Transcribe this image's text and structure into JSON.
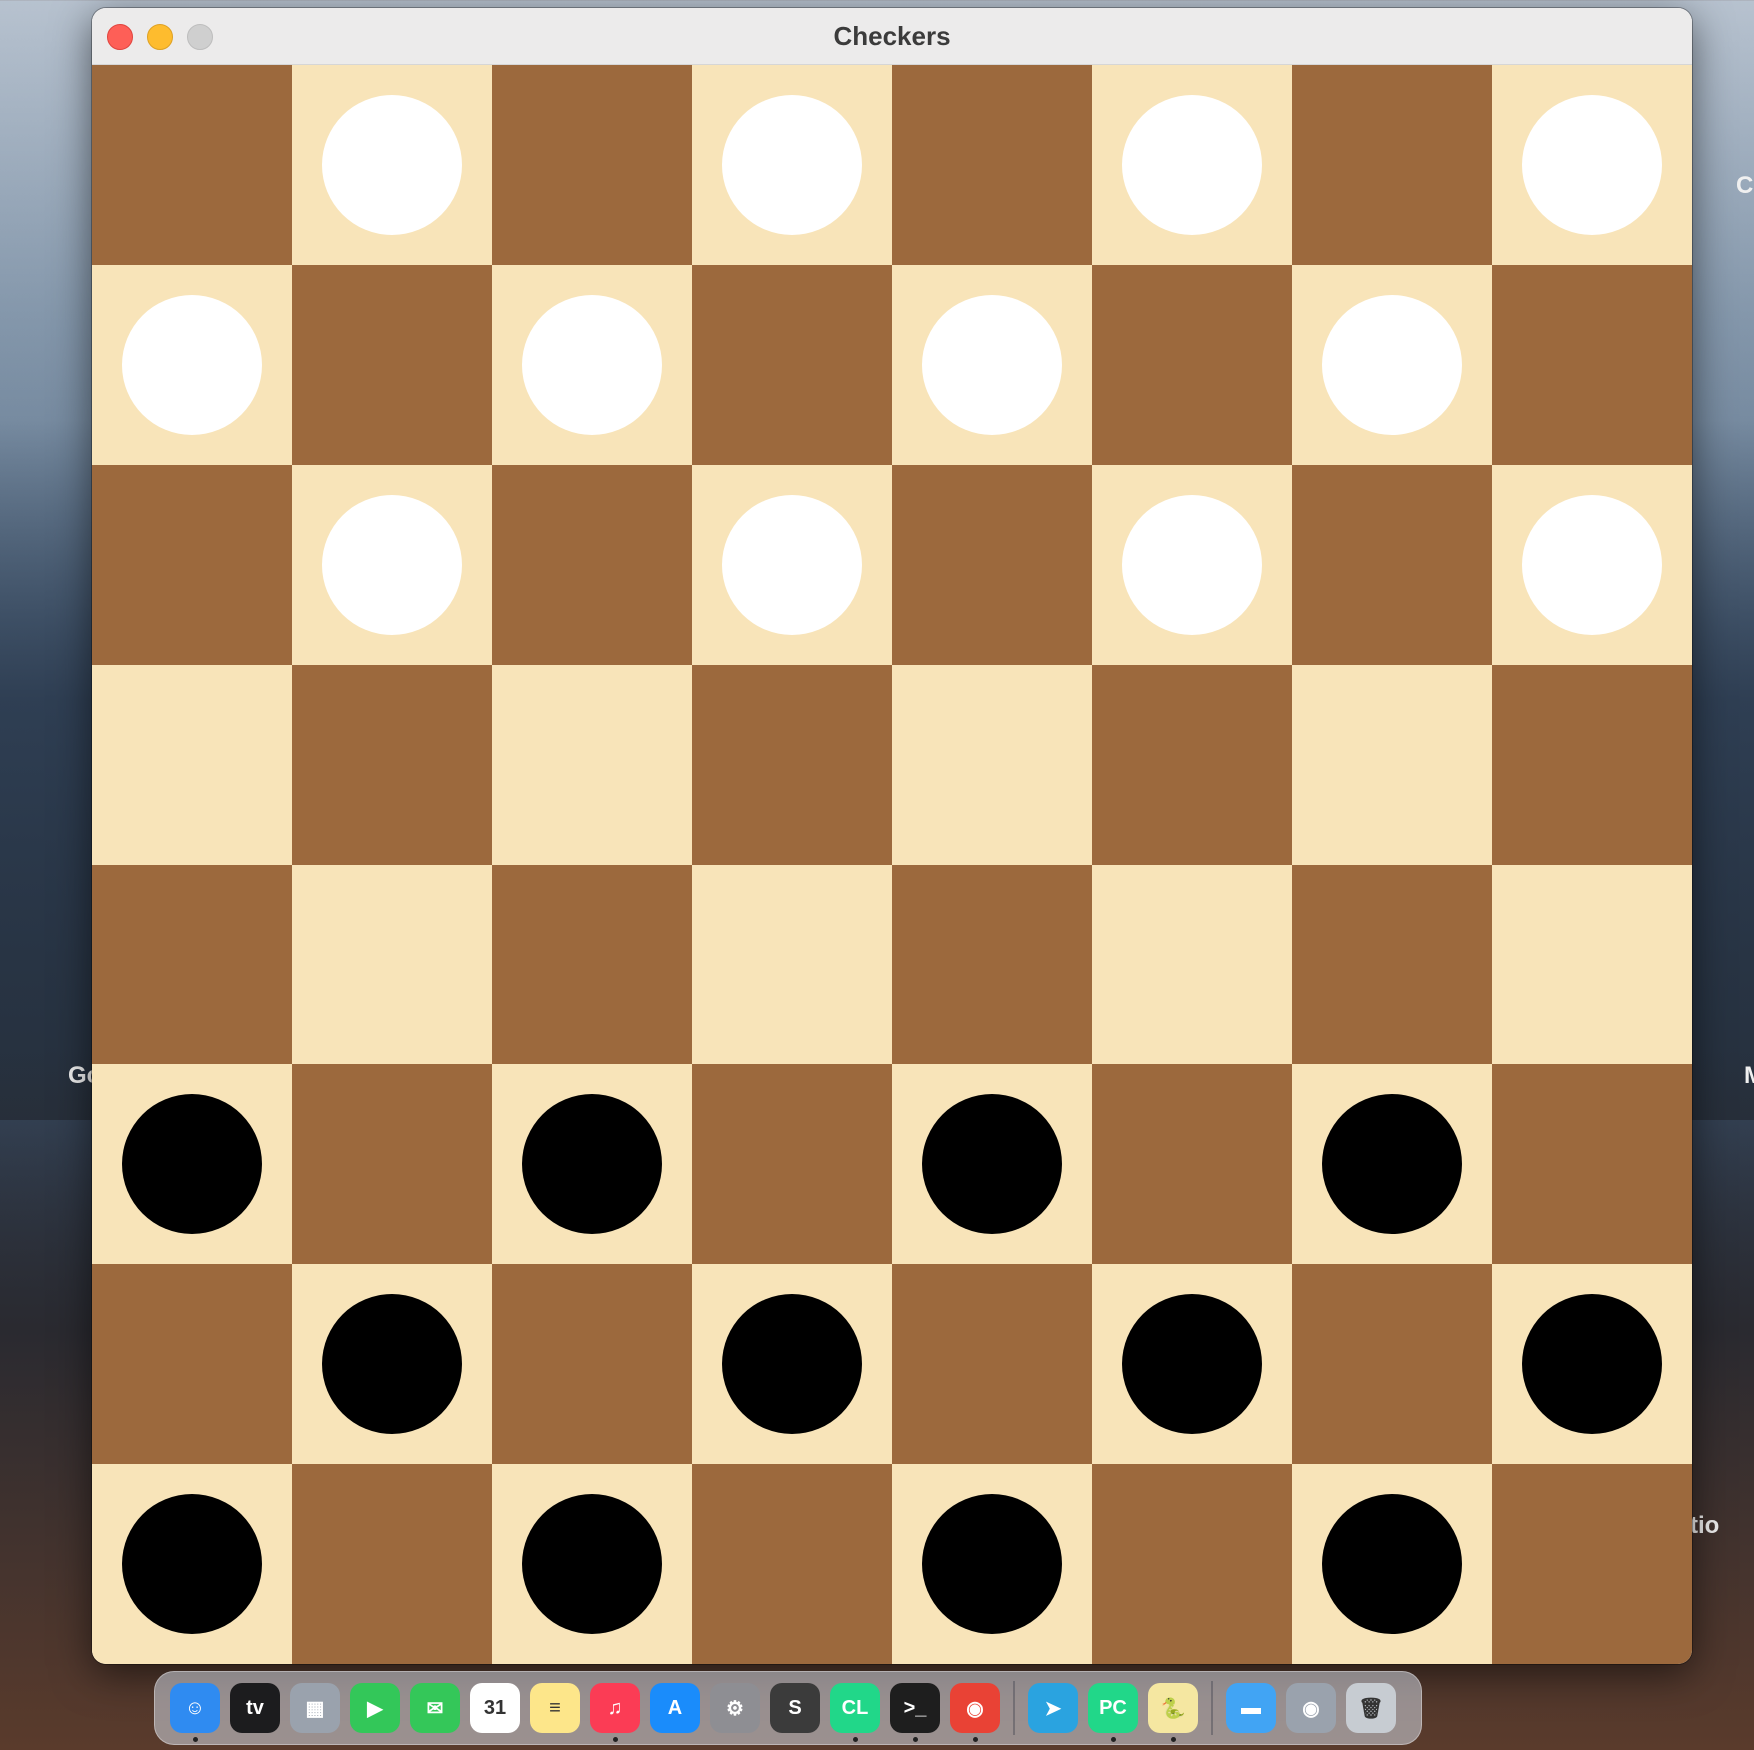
{
  "window": {
    "title": "Checkers"
  },
  "board": {
    "colors": {
      "light": "#f8e4b9",
      "dark": "#9c693d",
      "white_piece": "#ffffff",
      "black_piece": "#000000"
    },
    "rows": [
      ".w.w.w.w",
      "w.w.w.w.",
      ".w.w.w.w",
      "........",
      "........",
      "b.b.b.b.",
      ".b.b.b.b",
      "b.b.b.b."
    ]
  },
  "desktop": {
    "labels": [
      "Go",
      "Ch",
      "M",
      "tio"
    ]
  },
  "dock": {
    "items": [
      {
        "name": "finder-icon",
        "glyph": "☺",
        "color": "#2f8bf1",
        "running": true
      },
      {
        "name": "apple-tv-icon",
        "glyph": "tv",
        "color": "#1c1c1e",
        "running": false
      },
      {
        "name": "launchpad-icon",
        "glyph": "▦",
        "color": "#9aa2ad",
        "running": false
      },
      {
        "name": "facetime-icon",
        "glyph": "▶",
        "color": "#33c759",
        "running": false
      },
      {
        "name": "messages-icon",
        "glyph": "✉",
        "color": "#34c759",
        "running": false
      },
      {
        "name": "calendar-icon",
        "glyph": "31",
        "color": "#ffffff",
        "running": false
      },
      {
        "name": "notes-icon",
        "glyph": "≡",
        "color": "#fde68a",
        "running": false
      },
      {
        "name": "music-icon",
        "glyph": "♫",
        "color": "#fb3c55",
        "running": true
      },
      {
        "name": "app-store-icon",
        "glyph": "A",
        "color": "#1a8cfb",
        "running": false
      },
      {
        "name": "system-settings-icon",
        "glyph": "⚙",
        "color": "#8e8e93",
        "running": false
      },
      {
        "name": "sublime-text-icon",
        "glyph": "S",
        "color": "#3b3b3b",
        "running": false
      },
      {
        "name": "clion-icon",
        "glyph": "CL",
        "color": "#21d789",
        "running": true
      },
      {
        "name": "terminal-icon",
        "glyph": ">_",
        "color": "#1e1e1e",
        "running": true
      },
      {
        "name": "chrome-icon",
        "glyph": "◉",
        "color": "#e94235",
        "running": true
      },
      {
        "separator": true
      },
      {
        "name": "telegram-icon",
        "glyph": "➤",
        "color": "#2aa3e0",
        "running": false
      },
      {
        "name": "pycharm-icon",
        "glyph": "PC",
        "color": "#21d789",
        "running": true
      },
      {
        "name": "python-launcher-icon",
        "glyph": "🐍",
        "color": "#f5e7a1",
        "running": true
      },
      {
        "separator": true
      },
      {
        "name": "folder-icon",
        "glyph": "▬",
        "color": "#41a4f4",
        "running": false
      },
      {
        "name": "chrome-minimized-icon",
        "glyph": "◉",
        "color": "#9aa2ad",
        "running": false
      },
      {
        "name": "trash-icon",
        "glyph": "🗑",
        "color": "#c7ccd2",
        "running": false
      }
    ]
  }
}
